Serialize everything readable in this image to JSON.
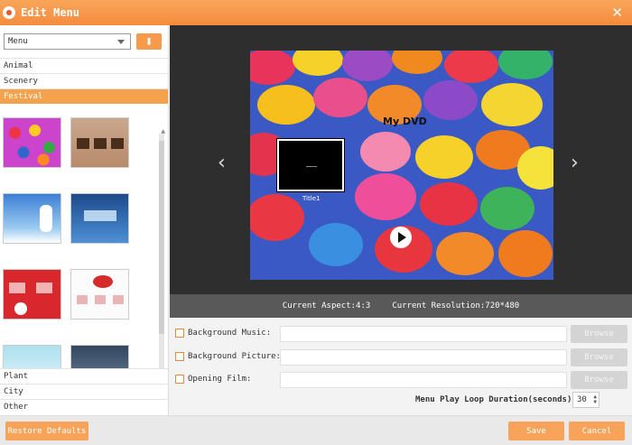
{
  "window": {
    "title": "Edit Menu"
  },
  "sidebar": {
    "dropdown_value": "Menu",
    "categories_top": [
      "Animal",
      "Scenery",
      "Festival"
    ],
    "active_category": "Festival",
    "categories_bottom": [
      "Plant",
      "City",
      "Other"
    ]
  },
  "preview": {
    "dvd_title": "My DVD",
    "chapter_label": "Title1",
    "aspect_text": "Current Aspect:4:3",
    "resolution_text": "Current Resolution:720*480"
  },
  "options": {
    "background_music_label": "Background Music:",
    "background_picture_label": "Background Picture:",
    "opening_film_label": "Opening Film:",
    "browse_label": "Browse",
    "loop_label": "Menu Play Loop Duration(seconds):",
    "loop_value": "30"
  },
  "footer": {
    "restore_label": "Restore Defaults",
    "save_label": "Save",
    "cancel_label": "Cancel"
  },
  "colors": {
    "accent": "#f5a24f",
    "titlebar": "#f58b3e",
    "disabled": "#d4d4d4"
  }
}
